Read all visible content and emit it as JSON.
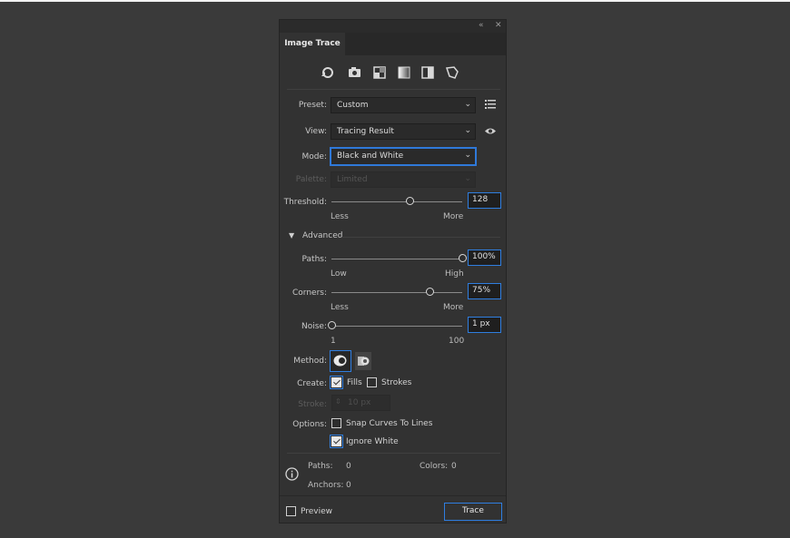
{
  "panel": {
    "title": "Image Trace",
    "collapse_icon": "double-chevron-left-icon",
    "close_icon": "close-icon"
  },
  "preset_icons": [
    "auto-color-icon",
    "high-color-icon",
    "low-color-icon",
    "grayscale-icon",
    "black-and-white-icon",
    "outline-icon"
  ],
  "preset": {
    "label": "Preset:",
    "value": "Custom"
  },
  "view": {
    "label": "View:",
    "value": "Tracing Result"
  },
  "mode": {
    "label": "Mode:",
    "value": "Black and White"
  },
  "palette": {
    "label": "Palette:",
    "value": "Limited"
  },
  "threshold": {
    "label": "Threshold:",
    "value": "128",
    "min_label": "Less",
    "max_label": "More",
    "level": 0.6
  },
  "advanced": {
    "label": "Advanced"
  },
  "paths": {
    "label": "Paths:",
    "value": "100%",
    "min_label": "Low",
    "max_label": "High",
    "level": 1.0
  },
  "corners": {
    "label": "Corners:",
    "value": "75%",
    "min_label": "Less",
    "max_label": "More",
    "level": 0.75
  },
  "noise": {
    "label": "Noise:",
    "value": "1 px",
    "min_label": "1",
    "max_label": "100",
    "level": 0.0
  },
  "method": {
    "label": "Method:"
  },
  "create": {
    "label": "Create:",
    "fills_label": "Fills",
    "strokes_label": "Strokes",
    "fills_checked": true,
    "strokes_checked": false
  },
  "stroke": {
    "label": "Stroke:",
    "value": "10 px"
  },
  "options": {
    "label": "Options:",
    "snap_label": "Snap Curves To Lines",
    "ignore_white_label": "Ignore White",
    "snap_checked": false,
    "ignore_white_checked": true
  },
  "stats": {
    "paths_label": "Paths:",
    "paths_value": "0",
    "colors_label": "Colors:",
    "colors_value": "0",
    "anchors_label": "Anchors:",
    "anchors_value": "0"
  },
  "footer": {
    "preview_label": "Preview",
    "trace_label": "Trace",
    "preview_checked": false
  },
  "colors": {
    "accent": "#2f7ee0",
    "panel_bg": "#323232",
    "page_bg": "#3a3a3a"
  }
}
